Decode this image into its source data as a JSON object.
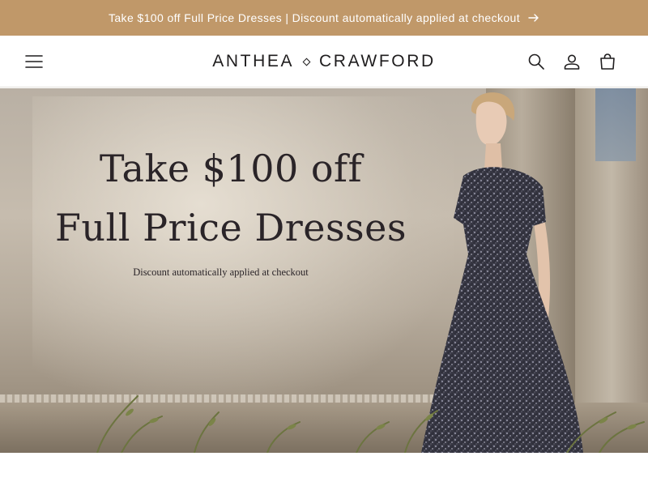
{
  "announcement": {
    "text": "Take $100 off Full Price Dresses | Discount automatically applied at checkout",
    "icon": "arrow-right-icon"
  },
  "header": {
    "logo_left": "ANTHEA",
    "logo_right": "CRAWFORD",
    "icons": [
      "menu-icon",
      "search-icon",
      "account-icon",
      "cart-icon"
    ]
  },
  "hero": {
    "line1": "Take $100 off",
    "line2": "Full Price Dresses",
    "subtext": "Discount automatically applied at checkout"
  },
  "colors": {
    "announcement_bg": "#c09869",
    "text_dark": "#1f1d1e"
  }
}
